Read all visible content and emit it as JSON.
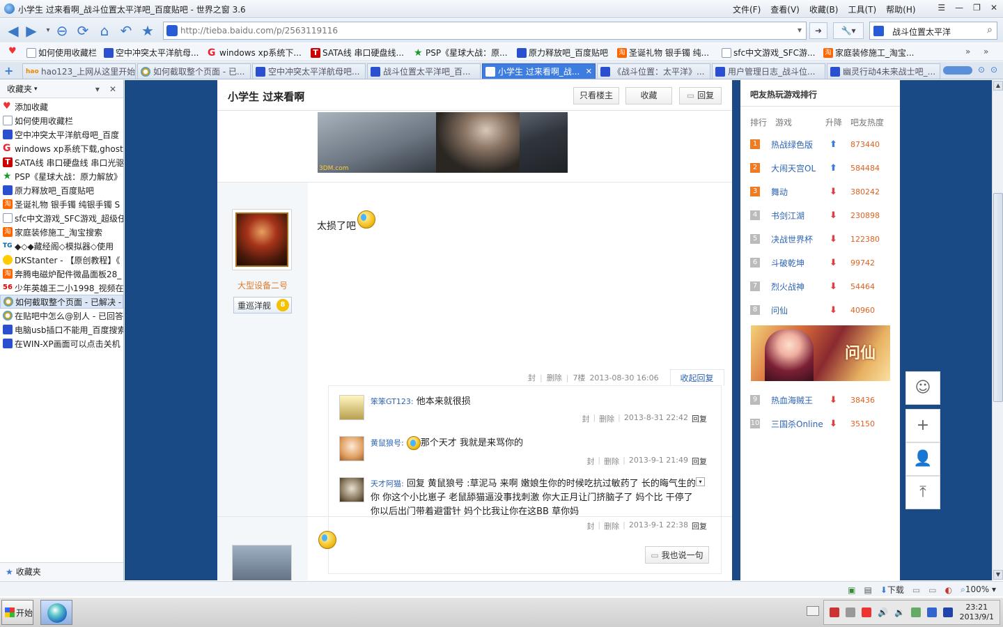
{
  "window": {
    "title": "小学生 过来看啊_战斗位置太平洋吧_百度贴吧 - 世界之窗 3.6",
    "menus": [
      "文件(F)",
      "查看(V)",
      "收藏(B)",
      "工具(T)",
      "帮助(H)"
    ]
  },
  "address": {
    "url": "http://tieba.baidu.com/p/2563119116"
  },
  "search": {
    "query": "战斗位置太平洋"
  },
  "bookmarks": [
    {
      "icon": "heart",
      "label": ""
    },
    {
      "icon": "doc",
      "label": "如何使用收藏栏"
    },
    {
      "icon": "baidu",
      "label": "空中冲突太平洋航母..."
    },
    {
      "icon": "g",
      "label": "windows xp系统下..."
    },
    {
      "icon": "t",
      "label": "SATA线 串口硬盘线..."
    },
    {
      "icon": "star",
      "label": "PSP《星球大战：原..."
    },
    {
      "icon": "baidu",
      "label": "原力释放吧_百度贴吧"
    },
    {
      "icon": "tao",
      "label": "圣诞礼物 银手镯 纯..."
    },
    {
      "icon": "doc",
      "label": "sfc中文游戏_SFC游..."
    },
    {
      "icon": "tao",
      "label": "家庭装修施工_淘宝..."
    }
  ],
  "tabs": [
    {
      "icon": "hao",
      "label": "hao123_上网从这里开始"
    },
    {
      "icon": "s",
      "label": "如何截取整个页面 - 已..."
    },
    {
      "icon": "baidu",
      "label": "空中冲突太平洋航母吧..."
    },
    {
      "icon": "baidu",
      "label": "战斗位置太平洋吧_百..."
    },
    {
      "icon": "baidu",
      "label": "小学生 过来看啊_战..."
    },
    {
      "icon": "baidu",
      "label": "《战斗位置：太平洋》..."
    },
    {
      "icon": "baidu",
      "label": "用户管理日志_战斗位..."
    },
    {
      "icon": "baidu",
      "label": "幽灵行动4未来战士吧_..."
    }
  ],
  "sidebar": {
    "title": "收藏夹",
    "footer": "收藏夹",
    "items": [
      {
        "icon": "heart",
        "label": "添加收藏"
      },
      {
        "icon": "doc",
        "label": "如何使用收藏栏"
      },
      {
        "icon": "baidu",
        "label": "空中冲突太平洋航母吧_百度"
      },
      {
        "icon": "g",
        "label": "windows xp系统下载,ghost"
      },
      {
        "icon": "t",
        "label": "SATA线 串口硬盘线 串口光驱"
      },
      {
        "icon": "star",
        "label": "PSP《星球大战：原力解放》"
      },
      {
        "icon": "baidu",
        "label": "原力释放吧_百度贴吧"
      },
      {
        "icon": "tao",
        "label": "圣诞礼物 银手镯 纯银手镯 S"
      },
      {
        "icon": "doc",
        "label": "sfc中文游戏_SFC游戏_超级任"
      },
      {
        "icon": "tao",
        "label": "家庭装修施工_淘宝搜索"
      },
      {
        "icon": "tg",
        "label": "◆◇◆藏经阁◇模拟器◇使用"
      },
      {
        "icon": "bulb",
        "label": "DKStanter - 【原创教程】《"
      },
      {
        "icon": "tao",
        "label": "奔腾电磁炉配件微晶面板28_"
      },
      {
        "icon": "56",
        "label": "少年英雄王二小1998_视频在"
      },
      {
        "icon": "s",
        "label": "如何截取整个页面 - 已解决 -"
      },
      {
        "icon": "s",
        "label": "在贴吧中怎么@别人 - 已回答"
      },
      {
        "icon": "baidu",
        "label": "电脑usb插口不能用_百度搜索"
      },
      {
        "icon": "baidu",
        "label": "在WIN-XP画面可以点击关机"
      }
    ]
  },
  "post": {
    "title": "小学生 过来看啊",
    "buttons": {
      "only_op": "只看楼主",
      "favorite": "收藏",
      "reply": "回复"
    },
    "image_watermark": "3DM.com",
    "floor": {
      "author": "大型设备二号",
      "badge": "重巡洋舰",
      "level": "8",
      "text": "太损了吧",
      "meta": [
        "封",
        "删除",
        "7楼",
        "2013-08-30 16:06"
      ],
      "collapse_reply": "收起回复",
      "replies": [
        {
          "user": "笨笨GT123:",
          "text": "他本来就很损",
          "meta": [
            "封",
            "删除",
            "2013-8-31 22:42"
          ],
          "reply": "回复"
        },
        {
          "user": "黄鼠狼号:",
          "text": "那个天才  我就是来骂你的",
          "meta": [
            "封",
            "删除",
            "2013-9-1 21:49"
          ],
          "reply": "回复"
        },
        {
          "user": "天才阿猫:",
          "text": "回复 黄鼠狼号 :草泥马 来啊 嫩娘生你的时候吃抗过敏药了 长的晦气生的你 你这个小比崽子 老鼠舔猫逼没事找刺激 你大正月让门挤脑子了 妈个比 干停了你以后出门带着避雷针 妈个比我让你在这BB 草你妈",
          "meta": [
            "封",
            "删除",
            "2013-9-1 22:38"
          ],
          "reply": "回复"
        }
      ],
      "say_button": "我也说一句"
    }
  },
  "ranking": {
    "title": "吧友热玩游戏排行",
    "headers": [
      "排行",
      "游戏",
      "升降",
      "吧友热度"
    ],
    "rows": [
      {
        "rank": "1",
        "game": "热战绿色版",
        "trend": "up",
        "heat": "873440"
      },
      {
        "rank": "2",
        "game": "大闹天宫OL",
        "trend": "up",
        "heat": "584484"
      },
      {
        "rank": "3",
        "game": "舞动",
        "trend": "down",
        "heat": "380242"
      },
      {
        "rank": "4",
        "game": "书剑江湖",
        "trend": "down",
        "heat": "230898"
      },
      {
        "rank": "5",
        "game": "决战世界杯",
        "trend": "down",
        "heat": "122380"
      },
      {
        "rank": "6",
        "game": "斗破乾坤",
        "trend": "down",
        "heat": "99742"
      },
      {
        "rank": "7",
        "game": "烈火战神",
        "trend": "down",
        "heat": "54464"
      },
      {
        "rank": "8",
        "game": "问仙",
        "trend": "down",
        "heat": "40960"
      },
      {
        "rank": "9",
        "game": "热血海贼王",
        "trend": "down",
        "heat": "38436"
      },
      {
        "rank": "10",
        "game": "三国杀Online",
        "trend": "down",
        "heat": "35150"
      }
    ],
    "banner_logo": "问仙"
  },
  "statusbar": {
    "download": "下载",
    "zoom": "100%"
  },
  "taskbar": {
    "start": "开始",
    "time": "23:21",
    "date": "2013/9/1"
  }
}
